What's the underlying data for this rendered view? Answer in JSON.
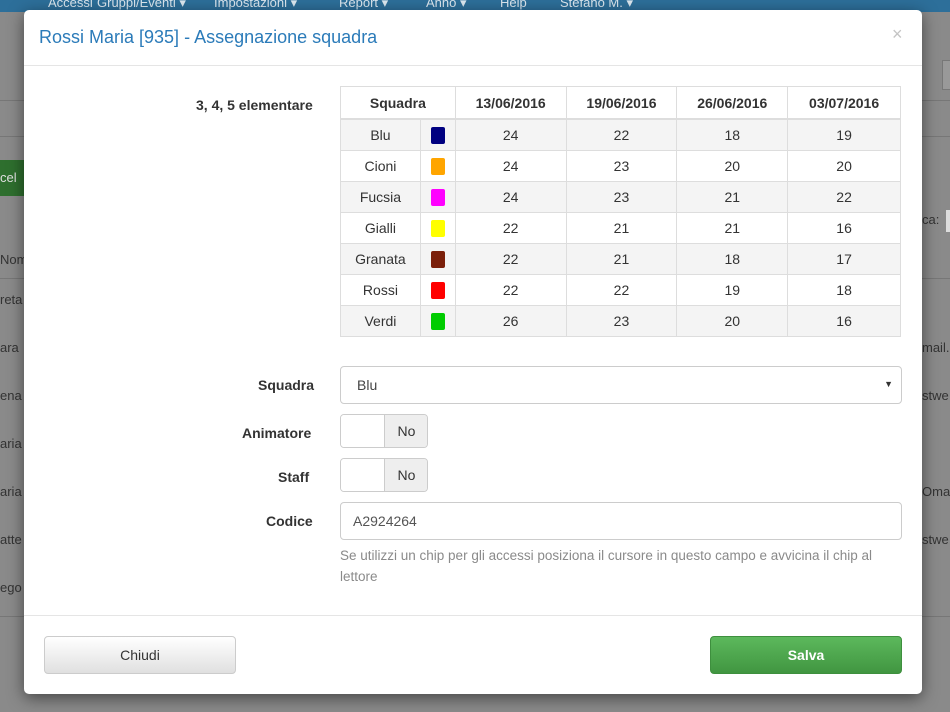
{
  "background": {
    "nav": [
      "Accessi",
      "Gruppi/Eventi ▾",
      "Impostazioni ▾",
      "Report ▾",
      "Anno ▾",
      "Help",
      "Stefano M. ▾"
    ],
    "left_fragments": [
      "cel",
      "Nom",
      "reta",
      "ara",
      "ena",
      "aria",
      "aria",
      "atte",
      "ego"
    ],
    "right_fragments": [
      "ca:",
      "mail.c",
      "stwe",
      "Omail",
      "stwe"
    ]
  },
  "modal": {
    "title_name": "Rossi Maria [935]",
    "title_sub": " - Assegnazione squadra",
    "close": "×",
    "section_label": "3, 4, 5 elementare",
    "table": {
      "headers": [
        "Squadra",
        "13/06/2016",
        "19/06/2016",
        "26/06/2016",
        "03/07/2016"
      ],
      "rows": [
        {
          "team": "Blu",
          "color": "#000080",
          "values": [
            "24",
            "22",
            "18",
            "19"
          ]
        },
        {
          "team": "Cioni",
          "color": "#FFA500",
          "values": [
            "24",
            "23",
            "20",
            "20"
          ]
        },
        {
          "team": "Fucsia",
          "color": "#FF00FF",
          "values": [
            "24",
            "23",
            "21",
            "22"
          ]
        },
        {
          "team": "Gialli",
          "color": "#FFFF00",
          "values": [
            "22",
            "21",
            "21",
            "16"
          ]
        },
        {
          "team": "Granata",
          "color": "#7B1F0A",
          "values": [
            "22",
            "21",
            "18",
            "17"
          ]
        },
        {
          "team": "Rossi",
          "color": "#FF0000",
          "values": [
            "22",
            "22",
            "19",
            "18"
          ]
        },
        {
          "team": "Verdi",
          "color": "#00CC00",
          "values": [
            "26",
            "23",
            "20",
            "16"
          ]
        }
      ]
    },
    "squadra_label": "Squadra",
    "squadra_value": "Blu",
    "animatore_label": "Animatore",
    "animatore_value": "No",
    "staff_label": "Staff",
    "staff_value": "No",
    "codice_label": "Codice",
    "codice_value": "A2924264",
    "codice_help": "Se utilizzi un chip per gli accessi posiziona il cursore in questo campo e avvicina il chip al lettore",
    "close_button": "Chiudi",
    "save_button": "Salva"
  }
}
